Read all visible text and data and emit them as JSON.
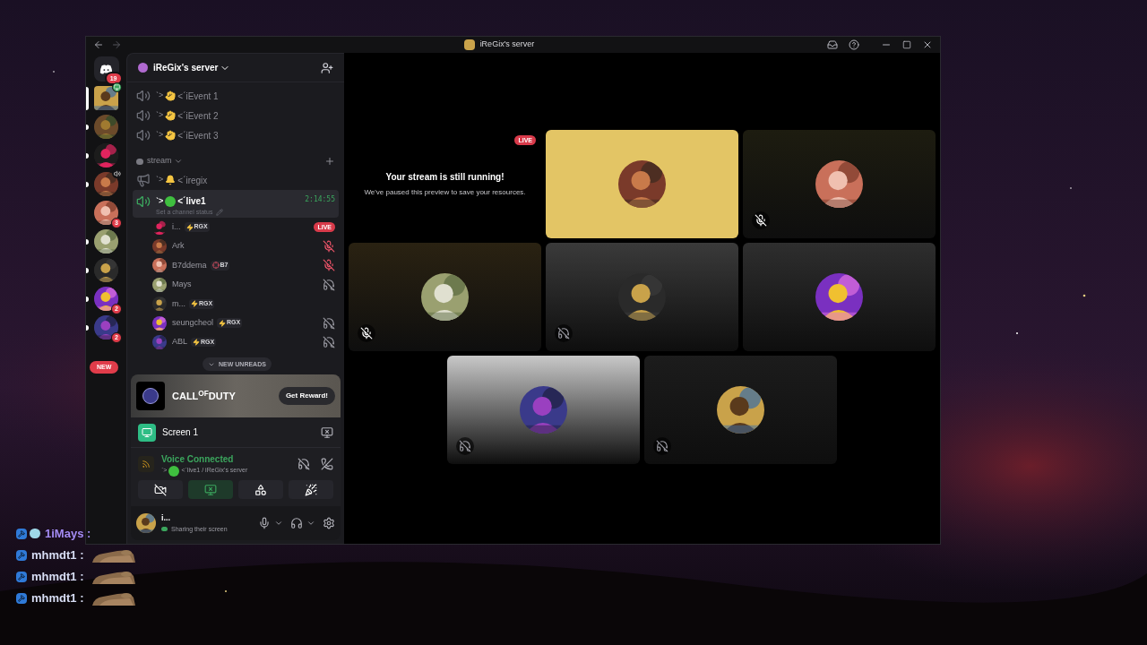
{
  "window": {
    "title": "iReGix's server"
  },
  "rail": {
    "home_badge": "19",
    "new_pill": "NEW",
    "servers": [
      {
        "selected": true,
        "badge_icon": {
          "kind": "screen"
        }
      },
      {
        "selected": false,
        "unread": true
      },
      {
        "selected": false,
        "unread": true
      },
      {
        "selected": false,
        "unread": true,
        "badge_icon": {
          "kind": "speaker"
        }
      },
      {
        "selected": false,
        "unread": false,
        "badge": "3"
      },
      {
        "selected": false,
        "unread": true
      },
      {
        "selected": false,
        "unread": true
      },
      {
        "selected": false,
        "unread": true,
        "badge": "2"
      },
      {
        "selected": false,
        "unread": true,
        "badge": "2"
      }
    ]
  },
  "server": {
    "name": "iReGix's server"
  },
  "channels": [
    {
      "kind": "voice",
      "selected": false,
      "prefix": "ˋ>",
      "emoji": {
        "kind": "hands"
      },
      "name": "<ˊiEvent 1"
    },
    {
      "kind": "voice",
      "selected": false,
      "prefix": "ˋ>",
      "emoji": {
        "kind": "hands"
      },
      "name": "<ˊiEvent 2"
    },
    {
      "kind": "voice",
      "selected": false,
      "prefix": "ˋ>",
      "emoji": {
        "kind": "hands"
      },
      "name": "<ˊiEvent 3"
    },
    {
      "kind": "category",
      "selected": false,
      "name": "stream"
    },
    {
      "kind": "announcement",
      "selected": false,
      "prefix": "ˋ>",
      "emoji": {
        "kind": "bell"
      },
      "name": "<ˊiregix"
    },
    {
      "kind": "voice",
      "selected": true,
      "prefix": "ˋ>",
      "emoji": {
        "kind": "dot"
      },
      "name": "<ˊlive1",
      "time": "2:14:55",
      "status": "Set a channel status",
      "users": [
        {
          "name": "i...",
          "tag": "RGX",
          "kind": "live",
          "badge": "LIVE"
        },
        {
          "name": "Ark",
          "kind": "mic_off"
        },
        {
          "name": "B7ddema",
          "tag": "B7",
          "kind": "mic_off"
        },
        {
          "name": "Mays",
          "kind": "deafened"
        },
        {
          "name": "m...",
          "tag": "RGX",
          "kind": "none"
        },
        {
          "name": "seungcheol",
          "tag": "RGX",
          "kind": "deafened"
        },
        {
          "name": "ABL",
          "tag": "RGX",
          "kind": "deafened"
        }
      ]
    }
  ],
  "unreads": "NEW UNREADS",
  "promo": {
    "brand": "CALL$^{OF}$DUTY",
    "button": "Get Reward!"
  },
  "stream": {
    "name": "Screen 1"
  },
  "voice": {
    "status": "Voice Connected",
    "prefix": "ˋ>",
    "location": "<ˊlive1 / iReGix's server"
  },
  "controls": [
    {
      "kind": "camera",
      "active": false
    },
    {
      "kind": "screen",
      "active": true
    },
    {
      "kind": "activities",
      "active": false
    },
    {
      "kind": "soundboard",
      "active": false
    }
  ],
  "user": {
    "name": "i...",
    "status": "Sharing their screen"
  },
  "stage": {
    "notice_title": "Your stream is still running!",
    "notice_text": "We've paused this preview to save your resources.",
    "live": "LIVE",
    "tiles": [
      {
        "color": "#e3c565",
        "kind": "none"
      },
      {
        "color": "#1d1c10",
        "kind": "mic_off"
      },
      {
        "color": "#2a2212",
        "kind": "mic_off"
      },
      {
        "color": "#3a3a3a",
        "kind": "deafened"
      },
      {
        "color": "#2e2e2e",
        "kind": "none"
      },
      {
        "color": "#c8c8c8",
        "kind": "deafened"
      },
      {
        "color": "#1c1c1c",
        "kind": "deafened"
      }
    ]
  },
  "chat": [
    {
      "name": "1iMays :",
      "color": "#a48cf4",
      "badges": [
        {
          "kind": "hammer"
        },
        {
          "kind": "bubble"
        }
      ]
    },
    {
      "name": "mhmdt1 :",
      "color": "#d8def5",
      "badges": [
        {
          "kind": "hammer"
        }
      ],
      "kind": "picture"
    },
    {
      "name": "mhmdt1 :",
      "color": "#d8def5",
      "badges": [
        {
          "kind": "hammer"
        }
      ],
      "kind": "picture"
    },
    {
      "name": "mhmdt1 :",
      "color": "#d8def5",
      "badges": [
        {
          "kind": "hammer"
        }
      ],
      "kind": "picture"
    }
  ]
}
